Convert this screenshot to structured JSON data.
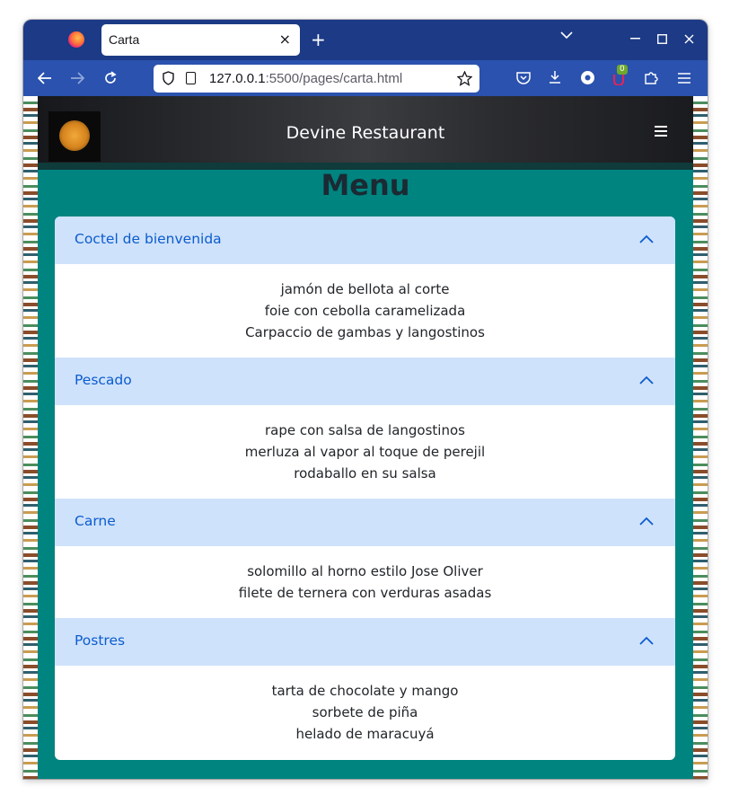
{
  "browser": {
    "tab_title": "Carta",
    "tab_close": "×",
    "new_tab": "+",
    "url_host": "127.0.0.1",
    "url_rest": ":5500/pages/carta.html",
    "extension_badge": "0",
    "icons": [
      "firefox-logo",
      "back-arrow",
      "forward-arrow",
      "reload",
      "shield",
      "page",
      "star",
      "pocket",
      "download",
      "extension",
      "puzzle",
      "menu"
    ]
  },
  "site": {
    "brand": "Devine Restaurant",
    "page_title": "Menu",
    "colors": {
      "page_bg": "#008480",
      "accordion_header": "#cfe2fb",
      "accordion_label": "#0b5ccf"
    }
  },
  "menu": {
    "sections": [
      {
        "label": "Coctel de bienvenida",
        "items": [
          "jamón de bellota al corte",
          "foie con cebolla caramelizada",
          "Carpaccio de gambas y langostinos"
        ]
      },
      {
        "label": "Pescado",
        "items": [
          "rape con salsa de langostinos",
          "merluza al vapor al toque de perejil",
          "rodaballo en su salsa"
        ]
      },
      {
        "label": "Carne",
        "items": [
          "solomillo al horno estilo Jose Oliver",
          "filete de ternera con verduras asadas"
        ]
      },
      {
        "label": "Postres",
        "items": [
          "tarta de chocolate y mango",
          "sorbete de piña",
          "helado de maracuyá"
        ]
      }
    ]
  }
}
